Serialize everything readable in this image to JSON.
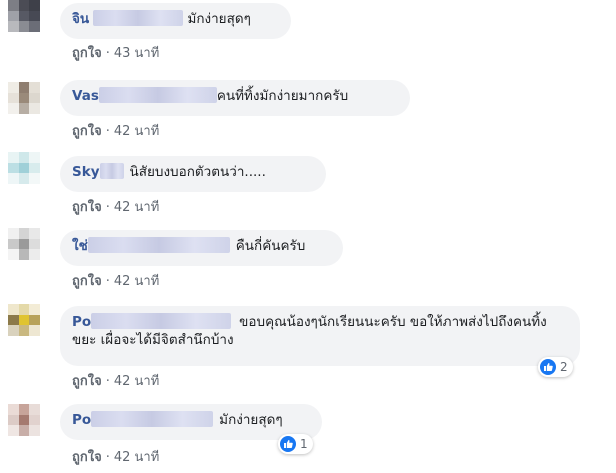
{
  "comments": [
    {
      "name": "จิน",
      "text": "มักง่ายสุดๆ",
      "like_label": "ถูกใจ",
      "time": "43 นาที",
      "avatar_colors": [
        "#7d7e85",
        "#4b4c55",
        "#3e4049",
        "#9fa1a8",
        "#575964",
        "#474954",
        "#b8b9bd",
        "#8a8c93",
        "#6b6d77"
      ]
    },
    {
      "name": "Vas",
      "text": "คนที่ทิ้งมักง่ายมากครับ",
      "like_label": "ถูกใจ",
      "time": "42 นาที",
      "avatar_colors": [
        "#efece5",
        "#8f7e70",
        "#e4dfd6",
        "#e6e1d9",
        "#9a8a7a",
        "#dcd7ce",
        "#f2f0ec",
        "#b7aea4",
        "#ebe8e2"
      ]
    },
    {
      "name": "Sky",
      "text": "นิสัยบงบอกตัวตนว่า.....",
      "like_label": "ถูกใจ",
      "time": "42 นาที",
      "avatar_colors": [
        "#e8f4f4",
        "#cfe8ea",
        "#eef6f6",
        "#bcdfe4",
        "#9fd0d8",
        "#d8eced",
        "#eef6f7",
        "#d6eaec",
        "#f3f8f8"
      ]
    },
    {
      "name": "ใช่",
      "text": "คืนกี่คันครับ",
      "like_label": "ถูกใจ",
      "time": "42 นาที",
      "avatar_colors": [
        "#f0f0f0",
        "#d4d4d4",
        "#e8e8e8",
        "#c9c9c9",
        "#9a9a9a",
        "#dcdcdc",
        "#f4f4f4",
        "#b8b8b8",
        "#ececec"
      ]
    },
    {
      "name": "Po",
      "text": "ขอบคุณน้องๆนักเรียนนะครับ ขอให้ภาพส่งไปถึงคนทิ้งขยะ เผื่อจะได้มีจิตสำนึกบ้าง",
      "like_label": "ถูกใจ",
      "time": "42 นาที",
      "reaction_count": "2",
      "avatar_colors": [
        "#efe7cc",
        "#e4d9a8",
        "#f3ecd6",
        "#8c7a4a",
        "#e0c430",
        "#b8a25a",
        "#d9d2bd",
        "#c9b880",
        "#eee7d2"
      ]
    },
    {
      "name": "Po",
      "text": "มักง่ายสุดๆ",
      "like_label": "ถูกใจ",
      "time": "42 นาที",
      "reaction_count": "1",
      "avatar_colors": [
        "#eadbd6",
        "#c7a49a",
        "#e8dcd8",
        "#dccbc6",
        "#a57a70",
        "#e1d2ce",
        "#efe6e3",
        "#c8aea8",
        "#ece3e0"
      ]
    }
  ]
}
